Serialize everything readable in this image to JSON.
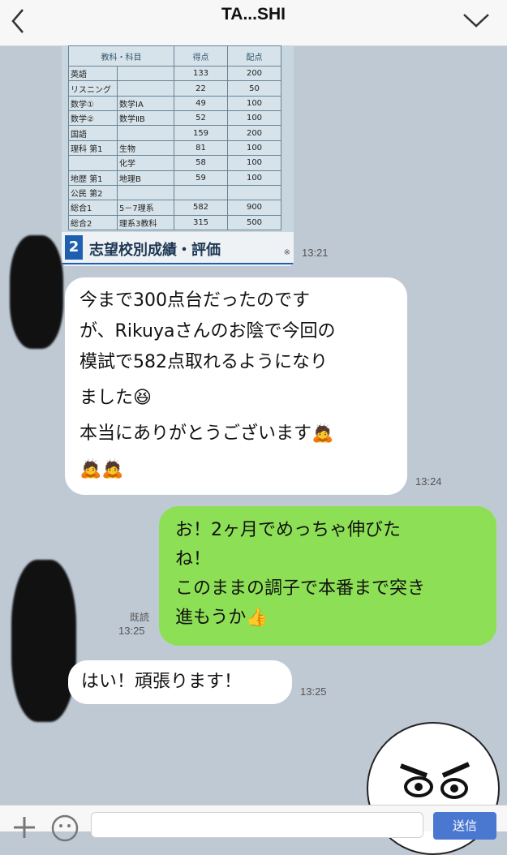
{
  "header": {
    "title": "TA...SHI"
  },
  "score_sheet": {
    "columns": [
      "教科・科目",
      "得点",
      "配点"
    ],
    "rows": [
      {
        "label": "英語",
        "sub": "",
        "score": "133",
        "max": "200"
      },
      {
        "label": "リスニング",
        "sub": "",
        "score": "22",
        "max": "50"
      },
      {
        "label": "数学①",
        "sub": "数学ⅠA",
        "score": "49",
        "max": "100"
      },
      {
        "label": "数学②",
        "sub": "数学ⅡB",
        "score": "52",
        "max": "100"
      },
      {
        "label": "国語",
        "sub": "",
        "score": "159",
        "max": "200"
      },
      {
        "label": "理科 第1",
        "sub": "生物",
        "score": "81",
        "max": "100"
      },
      {
        "label": "",
        "sub": "化学",
        "score": "58",
        "max": "100"
      },
      {
        "label": "地歴 第1",
        "sub": "地理B",
        "score": "59",
        "max": "100"
      },
      {
        "label": "公民 第2",
        "sub": "",
        "score": "",
        "max": ""
      },
      {
        "label": "総合1",
        "sub": "5－7理系",
        "score": "582",
        "max": "900"
      },
      {
        "label": "総合2",
        "sub": "理系3教科",
        "score": "315",
        "max": "500"
      }
    ],
    "section_number": "2",
    "section_title": "志望校別成績・評価",
    "section_note": "※"
  },
  "messages": [
    {
      "time": "13:21"
    },
    {
      "lines": [
        "今まで300点台だったのです",
        "が、Rikuyaさんのお陰で今回の",
        "模試で582点取れるようになり",
        "ました😆",
        "本当にありがとうございます🙇",
        "🙇🙇"
      ],
      "time": "13:24"
    },
    {
      "lines": [
        "お！2ヶ月でめっちゃ伸びた",
        "ね！",
        "このままの調子で本番まで突き",
        "進もうか👍"
      ],
      "read": "既読",
      "time": "13:25"
    },
    {
      "lines": [
        "はい！頑張ります！"
      ],
      "time": "13:25"
    }
  ],
  "input": {
    "placeholder": "",
    "send_label": "送信"
  },
  "colors": {
    "background": "#bfc9d4",
    "sent_bubble": "#8de055",
    "received_bubble": "#ffffff",
    "send_button": "#4a78d0"
  }
}
